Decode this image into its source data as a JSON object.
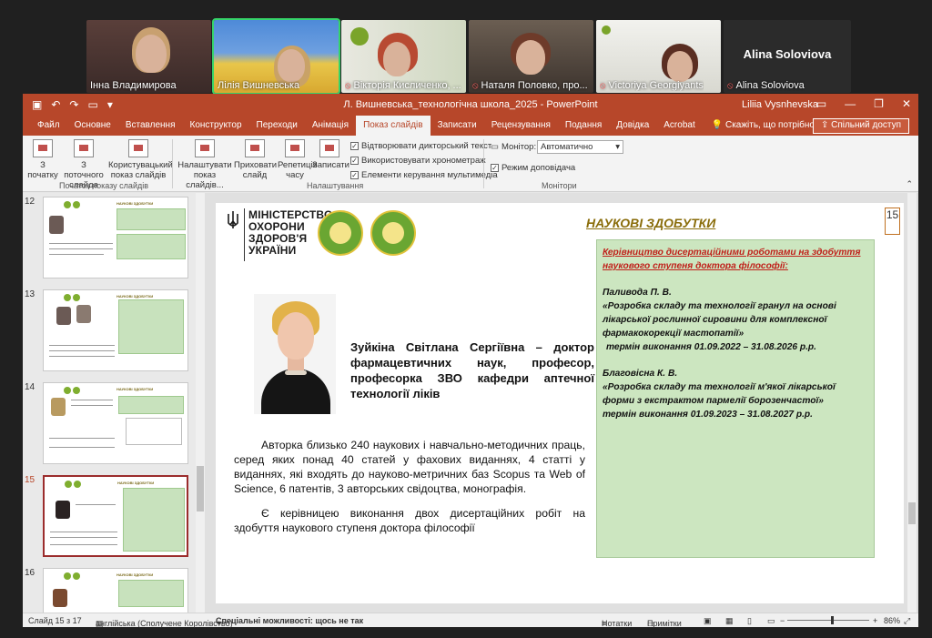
{
  "participants": [
    {
      "name": "Інна Владимирова",
      "muted": false
    },
    {
      "name": "Лілія Вишневська",
      "muted": false
    },
    {
      "name": "Вікторія Кисличенко, ...",
      "muted": true
    },
    {
      "name": "Наталя Половко, про...",
      "muted": true
    },
    {
      "name": "Victoriya Georgiyants",
      "muted": true
    },
    {
      "name": "Alina Soloviova",
      "muted": true,
      "big_name": "Alina Soloviova"
    }
  ],
  "window": {
    "title": "Л. Вишневська_технологічна школа_2025  -  PowerPoint",
    "user": "Liliia Vysnhevska",
    "controls": [
      "▭",
      "—",
      "❐",
      "✕"
    ]
  },
  "tabs": [
    "Файл",
    "Основне",
    "Вставлення",
    "Конструктор",
    "Переходи",
    "Анімація",
    "Показ слайдів",
    "Записати",
    "Рецензування",
    "Подання",
    "Довідка",
    "Acrobat"
  ],
  "selected_tab": "Показ слайдів",
  "tell_me": "Скажіть, що потрібно зробити",
  "share": "Спільний доступ",
  "ribbon": {
    "btn_from_start": "З початку",
    "btn_from_current": "З поточного слайда",
    "btn_custom": "Користувацький показ слайдів",
    "group_start": "Початок показу слайдів",
    "btn_setup": "Налаштувати показ слайдів...",
    "btn_hide": "Приховати слайд",
    "btn_rehearse": "Репетиція часу",
    "btn_record": "Записати",
    "chk_narration": "Відтворювати дикторський текст",
    "chk_timings": "Використовувати хронометраж",
    "chk_media": "Елементи керування мультимедіа",
    "group_setup": "Налаштування",
    "monitor_label": "Монітор:",
    "monitor_value": "Автоматично",
    "chk_presenter": "Режим доповідача",
    "group_monitors": "Монітори"
  },
  "thumbnails": [
    {
      "num": "12",
      "title": "НАУКОВІ ЗДОБУТКИ"
    },
    {
      "num": "13",
      "title": "НАУКОВІ ЗДОБУТКИ"
    },
    {
      "num": "14",
      "title": "НАУКОВІ ЗДОБУТКИ"
    },
    {
      "num": "15",
      "title": "НАУКОВІ ЗДОБУТКИ",
      "current": true
    },
    {
      "num": "16",
      "title": "НАУКОВІ ЗДОБУТКИ"
    }
  ],
  "slide": {
    "ministry": [
      "МІНІСТЕРСТВО",
      "ОХОРОНИ",
      "ЗДОРОВ'Я",
      "УКРАЇНИ"
    ],
    "heading": "НАУКОВІ ЗДОБУТКИ",
    "page_number": "15",
    "name_block": "Зуйкіна Світлана Сергіївна – доктор фармацевтичних наук, професор, професорка ЗВО кафедри аптечної технології ліків",
    "para1": "Авторка близько 240 наукових і навчально-методичних праць, серед яких понад 40 статей у фахових виданнях, 4 статті у виданнях, які входять до науково-метричних баз Scopus та Web of Science, 6 патентів, 3 авторських свідоцтва, монографія.",
    "para2": "Є керівницею виконання двох дисертаційних робіт на здобуття наукового ступеня доктора філософії",
    "box_title": "Керівництво дисертаційними роботами на здобуття наукового ступеня доктора філософії:",
    "box_item1_name": "Паливода П. В.",
    "box_item1_topic": "«Розробка складу та технології гранул на основі лікарської рослинної сировини для комплексної фармакокорекції мастопатії»",
    "box_item1_term": "термін виконання 01.09.2022 – 31.08.2026 р.р.",
    "box_item2_name": "Благовісна К. В.",
    "box_item2_topic": "«Розробка складу та технології м'якої лікарської форми з екстрактом пармелії борозенчастої»",
    "box_item2_term": "термін виконання 01.09.2023 – 31.08.2027 р.р."
  },
  "status": {
    "slide": "Слайд 15 з 17",
    "language": "англійська (Сполучене Королівство)",
    "accessibility": "Спеціальні можливості: щось не так",
    "notes": "Нотатки",
    "comments": "Примітки",
    "zoom": "86%"
  },
  "colors": {
    "accent": "#b7472a",
    "green_box": "#cce6c0",
    "heading_gold": "#8a6d0b",
    "red_text": "#c0201a"
  }
}
